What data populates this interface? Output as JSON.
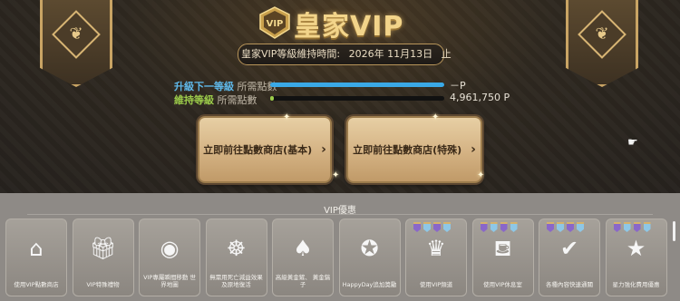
{
  "header": {
    "title": "皇家VIP",
    "crest_text": "VIP",
    "period_label": "皇家VIP等級維持時間:",
    "period_date": "2026年 11月13日",
    "period_suffix": "止"
  },
  "progress": {
    "upgrade": {
      "label_colored": "升級下一等級",
      "label_rest": "所需點數",
      "value": "－P",
      "fill_fraction": 1.0,
      "color": "#3aa9e6"
    },
    "maintain": {
      "label_colored": "維持等級",
      "label_rest": "所需點數",
      "value": "4,961,750 P",
      "fill_fraction": 0.02,
      "color": "#9ccc4a"
    }
  },
  "buttons": {
    "shop_basic": "立即前往點數商店(基本)",
    "shop_special": "立即前往點數商店(特殊)"
  },
  "benefits": {
    "title": "VIP優惠",
    "items": [
      {
        "label": "使用VIP點數商店",
        "icon": "shop-icon"
      },
      {
        "label": "VIP特殊禮物",
        "icon": "gift-icon"
      },
      {
        "label": "VIP專屬瞬間移動 世界地圖",
        "icon": "portal-icon"
      },
      {
        "label": "無需用死亡減益效果 及原地復活",
        "icon": "wheel-icon"
      },
      {
        "label": "高級黃金鏟、 黃金鎬子",
        "icon": "shovel-icon"
      },
      {
        "label": "HappyDay追加獎勵",
        "icon": "badge-icon"
      },
      {
        "label": "使用VIP頻道",
        "icon": "crown-icon"
      },
      {
        "label": "使用VIP休息室",
        "icon": "sofa-icon"
      },
      {
        "label": "各種內容快速通關",
        "icon": "check-icon"
      },
      {
        "label": "星力強化費用優惠",
        "icon": "star-icon"
      }
    ]
  },
  "colors": {
    "accent_gold": "#d4b26c",
    "panel_gray": "#8e8a86",
    "flag_colors": [
      "#8a67c9",
      "#8ec7e6",
      "#8a67c9",
      "#8ec7e6"
    ]
  }
}
